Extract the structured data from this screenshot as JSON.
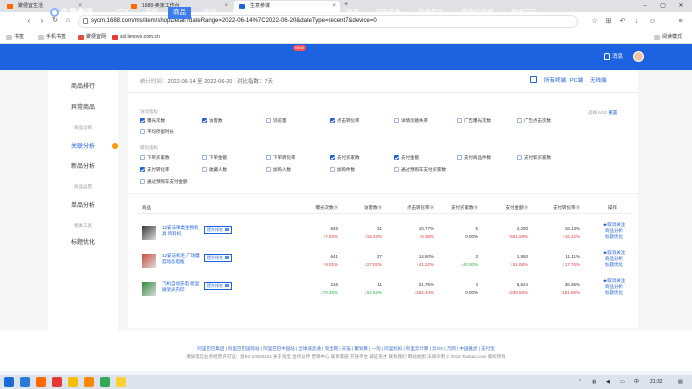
{
  "browser": {
    "tabs": [
      {
        "label": "聚便宜生活",
        "active": false
      },
      {
        "label": "1688-卖家工作台",
        "active": false
      },
      {
        "label": "生意参谋",
        "active": true
      }
    ],
    "url": "sycm.1688.com/ms/item/shopDetail?dateRange=2022-06-14%7C2022-06-20&dateType=recent7&device=0",
    "bookmarks": [
      "书签",
      "手机书签",
      "聚便宜网",
      "ssl.lenovo.com.cn"
    ],
    "right_link": "阅读模式"
  },
  "topnav": {
    "logo": "生意参谋",
    "items": [
      "首页",
      "流量",
      "商品",
      "营销",
      "客户",
      "营销",
      "内容",
      "交易",
      "服务",
      "市场竞争",
      "业务专区",
      "爆款实验室",
      "数据学堂"
    ],
    "active_index": 2,
    "new_badge": "NEW",
    "message": "消息"
  },
  "sidebar": {
    "items": [
      {
        "label": "商品排行",
        "type": "item"
      },
      {
        "label": "异常商品",
        "type": "item"
      },
      {
        "label": "商品诊断",
        "type": "section"
      },
      {
        "label": "关联分析",
        "type": "item",
        "active": true
      },
      {
        "label": "新品分析",
        "type": "item"
      },
      {
        "label": "商品运营",
        "type": "section"
      },
      {
        "label": "单品分析",
        "type": "item"
      },
      {
        "label": "相关工具",
        "type": "section"
      },
      {
        "label": "标题优化",
        "type": "item"
      }
    ]
  },
  "header": {
    "stat_time_label": "统计时间：",
    "date_range": "2022-06-14 至 2022-06-20",
    "compare_label": "对比指数：",
    "compare_value": "7天",
    "terminal_links": [
      "所有终端",
      "PC端",
      "无线端"
    ]
  },
  "metrics": {
    "traffic_label": "访问指标",
    "traffic": [
      {
        "label": "曝光次数",
        "checked": true
      },
      {
        "label": "访客数",
        "checked": true
      },
      {
        "label": "浏览量",
        "checked": false
      },
      {
        "label": "点击转化率",
        "checked": true
      },
      {
        "label": "详情页跳失率",
        "checked": false
      },
      {
        "label": "广告曝光次数",
        "checked": false
      },
      {
        "label": "广告点击次数",
        "checked": false
      },
      {
        "label": "平均停留时长",
        "checked": false
      }
    ],
    "trade_label": "转化指标",
    "trade": [
      {
        "label": "下单买家数",
        "checked": false
      },
      {
        "label": "下单金额",
        "checked": false
      },
      {
        "label": "下单转化率",
        "checked": false
      },
      {
        "label": "支付买家数",
        "checked": true
      },
      {
        "label": "支付金额",
        "checked": true
      },
      {
        "label": "支付商品件数",
        "checked": false
      },
      {
        "label": "支付新买家数",
        "checked": false
      },
      {
        "label": "支付转化率",
        "checked": true
      },
      {
        "label": "收藏人数",
        "checked": false
      },
      {
        "label": "加购人数",
        "checked": false
      },
      {
        "label": "加购件数",
        "checked": false
      },
      {
        "label": "通过预购车支付买家数",
        "checked": false
      },
      {
        "label": "通过预购车支付金额",
        "checked": false
      }
    ],
    "selected_text": "选择 6/10",
    "reset": "重置"
  },
  "table": {
    "headers": [
      "商品",
      "曝光次数",
      "访客数",
      "点击转化率",
      "支付买家数",
      "支付金额",
      "支付转化率",
      "操作"
    ],
    "rows": [
      {
        "name": "12安法律类生物机具 鸡料机",
        "tag": "提升排名",
        "cells": [
          "845",
          "31",
          "10.77%",
          "5",
          "4,200",
          "16.13%"
        ],
        "changes": [
          [
            "up",
            "↑7.92%"
          ],
          [
            "up",
            "↑19.23%"
          ],
          [
            "up",
            "↑5.38%"
          ],
          [
            "neu",
            "0.00%"
          ],
          [
            "up",
            "↑661.58%"
          ],
          [
            "up",
            "↑16.12%"
          ]
        ],
        "ops": [
          "★取消关注",
          "商品分析",
          "标题优化"
        ],
        "img_color": "#3a3a3a"
      },
      {
        "name": "12安法机毛 广场蘑菇动态电瓶",
        "tag": "提升排名",
        "cells": [
          "641",
          "27",
          "14.80%",
          "3",
          "1,950",
          "11.11%"
        ],
        "changes": [
          [
            "up",
            "↑9.01%"
          ],
          [
            "up",
            "↑27.02%"
          ],
          [
            "up",
            "↑41.22%"
          ],
          [
            "dn",
            "↓40.00%"
          ],
          [
            "up",
            "↑51.08%"
          ],
          [
            "up",
            "↑17.76%"
          ]
        ],
        "ops": [
          "★取消关注",
          "商品分析",
          "标题优化"
        ],
        "img_color": "#c94f3a"
      },
      {
        "name": "飞机自动充电 舱里展架光内印",
        "tag": "提升排名",
        "cells": [
          "216",
          "11",
          "21.76%",
          "4",
          "5,624",
          "36.36%"
        ],
        "changes": [
          [
            "dn",
            "↓70.45%"
          ],
          [
            "dn",
            "↓64.52%"
          ],
          [
            "up",
            "↑152.44%"
          ],
          [
            "neu",
            "0.00%"
          ],
          [
            "up",
            "↑239.53%"
          ],
          [
            "up",
            "↑181.86%"
          ]
        ],
        "ops": [
          "★取消关注",
          "商品分析",
          "标题优化"
        ],
        "img_color": "#2f8a3c"
      }
    ]
  },
  "footer": {
    "links": "阿里巴巴集团 | 阿里巴巴国际站 | 阿里巴巴中国站 | 全球速卖通 | 淘宝网 | 天猫 | 聚划算 | 一淘 | 阿里妈妈 | 阿里云计算 | 云OS | 万网 | 中国雅虎 | 支付宝",
    "legal": "增值电信业务经营许可证：浙B2-20080224 关于淘宝 合作伙伴 营销中心 联系客服 开放平台 诚征英才 联系我们 网站地图 法律声明 © 2016 Taobao.com 版权所有"
  },
  "taskbar": {
    "lang": "中",
    "time": "21:32"
  }
}
